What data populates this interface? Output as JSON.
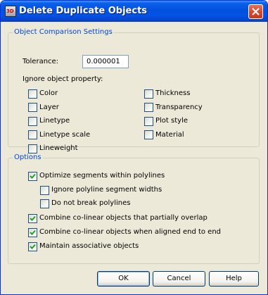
{
  "window": {
    "title": "Delete Duplicate Objects",
    "app_icon": "3D",
    "close_icon": "close-x-icon"
  },
  "comparison": {
    "title": "Object Comparison Settings",
    "tolerance_label": "Tolerance:",
    "tolerance_value": "0.000001",
    "ignore_label": "Ignore object property:",
    "left_props": [
      {
        "label": "Color",
        "checked": false
      },
      {
        "label": "Layer",
        "checked": false
      },
      {
        "label": "Linetype",
        "checked": false
      },
      {
        "label": "Linetype scale",
        "checked": false
      },
      {
        "label": "Lineweight",
        "checked": false
      }
    ],
    "right_props": [
      {
        "label": "Thickness",
        "checked": false
      },
      {
        "label": "Transparency",
        "checked": false
      },
      {
        "label": "Plot style",
        "checked": false
      },
      {
        "label": "Material",
        "checked": false
      }
    ]
  },
  "options": {
    "title": "Options",
    "items": [
      {
        "label": "Optimize segments within polylines",
        "checked": true
      },
      {
        "label": "Ignore polyline segment widths",
        "checked": false
      },
      {
        "label": "Do not break polylines",
        "checked": false
      },
      {
        "label": "Combine co-linear objects that partially overlap",
        "checked": true
      },
      {
        "label": "Combine co-linear objects when aligned end to end",
        "checked": true
      },
      {
        "label": "Maintain associative objects",
        "checked": true
      }
    ]
  },
  "buttons": {
    "ok": "OK",
    "cancel": "Cancel",
    "help": "Help"
  },
  "colors": {
    "titlebar": "#0451e0",
    "group_title": "#0046d5",
    "dialog_bg": "#ece9d8",
    "check": "#21a121"
  }
}
